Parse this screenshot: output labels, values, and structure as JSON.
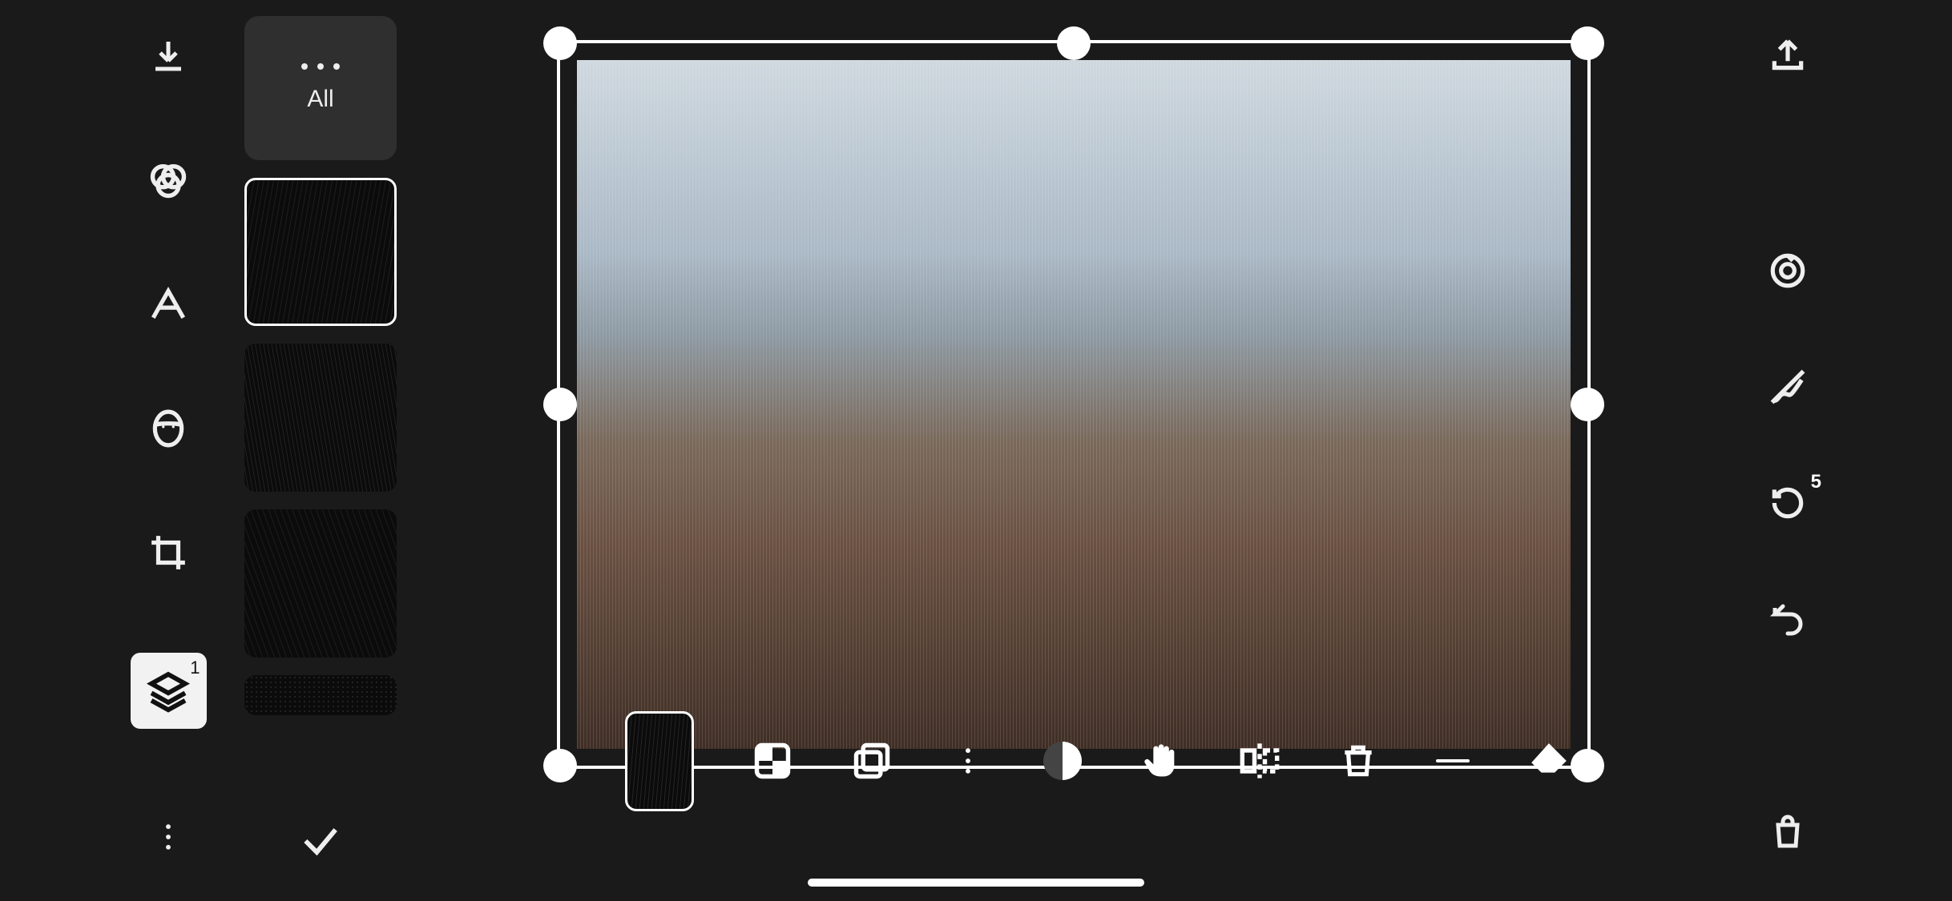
{
  "left_toolbar": {
    "items": [
      "download",
      "filters",
      "text",
      "face",
      "crop",
      "layers",
      "more"
    ],
    "layers_badge": "1"
  },
  "overlay_panel": {
    "filter_tab_label": "All",
    "selected_index": 0,
    "thumbs": [
      "rain-1",
      "rain-2",
      "rain-3",
      "noise-1"
    ]
  },
  "bottom_tools": {
    "items": [
      "current-overlay",
      "transparency",
      "duplicate",
      "more",
      "contrast",
      "hand",
      "flip",
      "trash",
      "subtract",
      "eraser"
    ]
  },
  "right_toolbar": {
    "items": [
      "share",
      "target",
      "brush",
      "history",
      "undo",
      "shop"
    ],
    "history_badge": "5"
  }
}
